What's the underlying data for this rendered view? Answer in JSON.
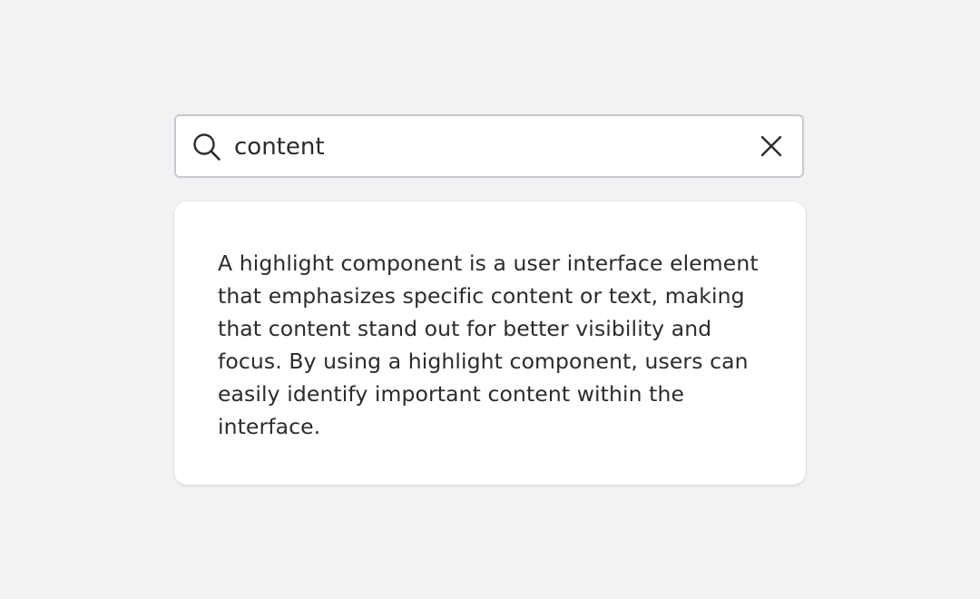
{
  "search": {
    "value": "content",
    "icon": "search-icon",
    "clear_icon": "close-icon"
  },
  "result": {
    "text": "A highlight component is a user interface element that emphasizes specific content or text, making that content stand out for better visibility and focus. By using a highlight component, users can easily identify important content within the interface."
  },
  "colors": {
    "background": "#f2f2f4",
    "card": "#ffffff",
    "border": "#c9c9cd",
    "text": "#2b2b2f"
  }
}
